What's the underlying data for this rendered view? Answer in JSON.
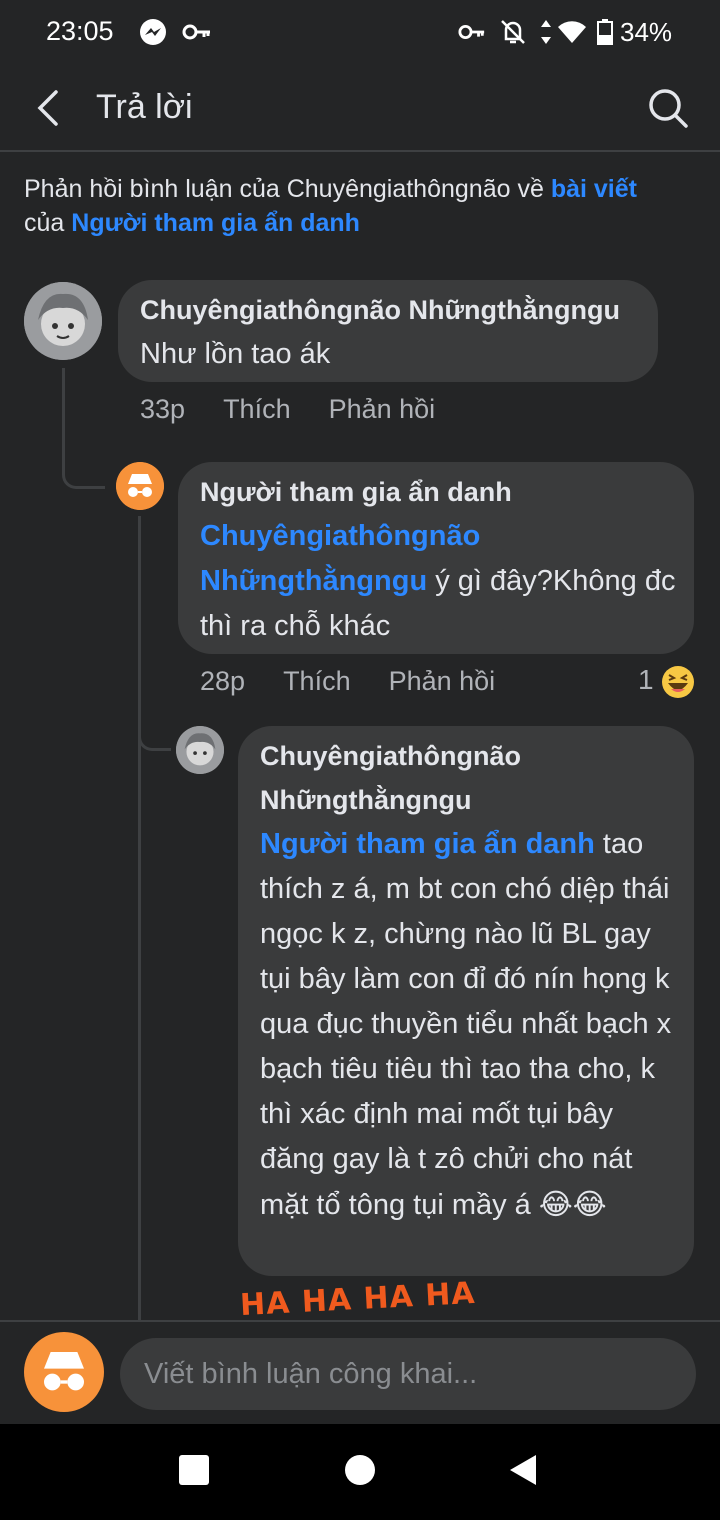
{
  "status_bar": {
    "time": "23:05",
    "battery": "34%",
    "icons": [
      "messenger-icon",
      "key-icon",
      "vpn-key-icon",
      "bell-off-icon",
      "data-arrows-icon",
      "wifi-icon",
      "battery-icon"
    ]
  },
  "header": {
    "title": "Trả lời",
    "back_icon": "chevron-left-icon",
    "search_icon": "search-icon"
  },
  "context": {
    "prefix": "Phản hồi bình luận của Chuyêngiathôngnão về ",
    "post_link": "bài viết",
    "middle": " của ",
    "author_link": "Người tham gia ẩn danh"
  },
  "comments": [
    {
      "author": "Chuyêngiathôngnão Nhữngthằngngu",
      "text": "Như lồn tao ák",
      "time": "33p",
      "like": "Thích",
      "reply": "Phản hồi"
    },
    {
      "author": "Người tham gia ẩn danh",
      "mention": "Chuyêngiathôngnão Nhữngthằngngu",
      "text": " ý gì đây?Không đc thì ra chỗ khác",
      "time": "28p",
      "like": "Thích",
      "reply": "Phản hồi",
      "reaction_count": "1",
      "reaction_icon": "laughing-emoji-icon"
    },
    {
      "author": "Chuyêngiathôngnão Nhữngthằngngu",
      "mention": "Người tham gia ẩn danh",
      "text": " tao thích z á, m bt con chó diệp thái ngọc k z, chừng nào lũ BL gay tụi bây làm con đỉ đó nín họng k qua đục thuyền tiểu nhất bạch x bạch tiêu tiêu thì tao tha cho, k thì xác định mai mốt tụi bây đăng gay là t zô chửi cho nát mặt tổ tông tụi mầy á ",
      "emojis": "😂😂",
      "sticker": "HA HA HA HA"
    }
  ],
  "compose": {
    "placeholder": "Viết bình luận công khai..."
  },
  "nav_bar": {
    "buttons": [
      "square-recent-icon",
      "circle-home-icon",
      "triangle-back-icon"
    ]
  },
  "colors": {
    "background": "#242526",
    "bubble": "#3a3b3c",
    "link": "#2d88ff",
    "anon_avatar": "#f7923a"
  }
}
